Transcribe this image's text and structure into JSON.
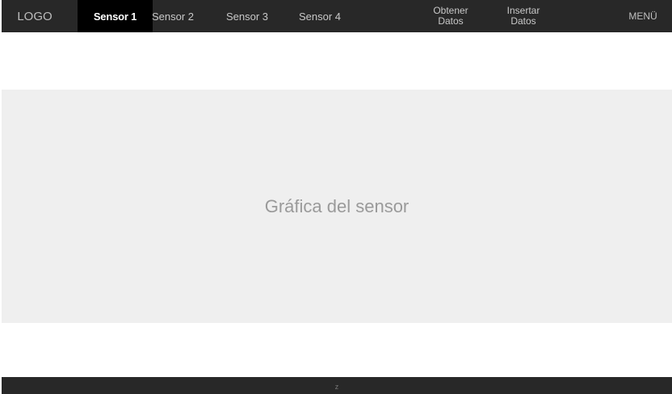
{
  "nav": {
    "logo": "LOGO",
    "tabs": [
      {
        "label": "Sensor 1",
        "active": true
      },
      {
        "label": "Sensor 2",
        "active": false
      },
      {
        "label": "Sensor 3",
        "active": false
      },
      {
        "label": "Sensor 4",
        "active": false
      }
    ],
    "obtener": {
      "line1": "Obtener",
      "line2": "Datos"
    },
    "insertar": {
      "line1": "Insertar",
      "line2": "Datos"
    },
    "menu": "MENÜ"
  },
  "main": {
    "chart_placeholder": "Gráfica del sensor"
  },
  "footer": {
    "text": "z"
  },
  "colors": {
    "nav_bg": "#282828",
    "active_tab_bg": "#000000",
    "panel_bg": "#efefef",
    "placeholder_text": "#9a9a9a"
  }
}
